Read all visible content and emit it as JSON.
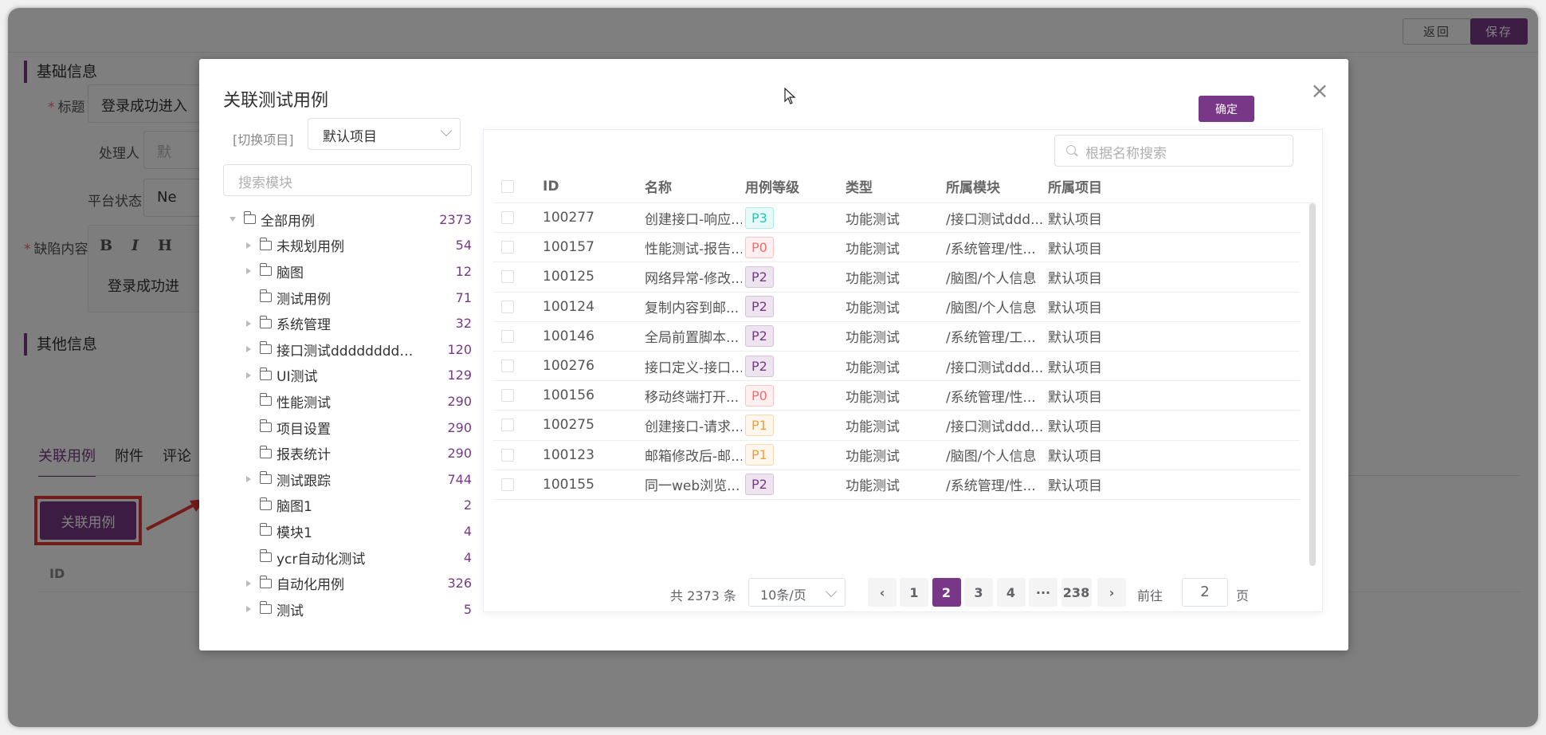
{
  "header": {
    "back_label": "返回",
    "save_label": "保存"
  },
  "form": {
    "basic_section": "基础信息",
    "title_label": "标题",
    "title_value": "登录成功进入",
    "handler_label": "处理人",
    "handler_value": "默",
    "status_label": "平台状态",
    "status_value": "Ne",
    "content_label": "缺陷内容",
    "content_value": "登录成功进",
    "editor_tools": [
      "B",
      "I",
      "H"
    ],
    "other_section": "其他信息",
    "tabs": [
      "关联用例",
      "附件",
      "评论"
    ],
    "relate_button": "关联用例",
    "table_id_header": "ID"
  },
  "dialog": {
    "title": "关联测试用例",
    "confirm_label": "确定",
    "switch_project_label": "[切换项目]",
    "project_value": "默认项目",
    "module_search_placeholder": "搜索模块",
    "name_search_placeholder": "根据名称搜索",
    "tree": [
      {
        "label": "全部用例",
        "count": "2373",
        "level": 0,
        "toggle": "open"
      },
      {
        "label": "未规划用例",
        "count": "54",
        "level": 1,
        "toggle": "closed"
      },
      {
        "label": "脑图",
        "count": "12",
        "level": 1,
        "toggle": "closed"
      },
      {
        "label": "测试用例",
        "count": "71",
        "level": 1,
        "toggle": "none"
      },
      {
        "label": "系统管理",
        "count": "32",
        "level": 1,
        "toggle": "closed"
      },
      {
        "label": "接口测试dddddddddd...",
        "count": "120",
        "level": 1,
        "toggle": "closed"
      },
      {
        "label": "UI测试",
        "count": "129",
        "level": 1,
        "toggle": "closed"
      },
      {
        "label": "性能测试",
        "count": "290",
        "level": 1,
        "toggle": "none"
      },
      {
        "label": "项目设置",
        "count": "290",
        "level": 1,
        "toggle": "none"
      },
      {
        "label": "报表统计",
        "count": "290",
        "level": 1,
        "toggle": "none"
      },
      {
        "label": "测试跟踪",
        "count": "744",
        "level": 1,
        "toggle": "closed"
      },
      {
        "label": "脑图1",
        "count": "2",
        "level": 1,
        "toggle": "none"
      },
      {
        "label": "模块1",
        "count": "4",
        "level": 1,
        "toggle": "none"
      },
      {
        "label": "ycr自动化测试",
        "count": "4",
        "level": 1,
        "toggle": "none"
      },
      {
        "label": "自动化用例",
        "count": "326",
        "level": 1,
        "toggle": "closed"
      },
      {
        "label": "测试",
        "count": "5",
        "level": 1,
        "toggle": "closed"
      }
    ],
    "columns": [
      "ID",
      "名称",
      "用例等级",
      "类型",
      "所属模块",
      "所属项目"
    ],
    "rows": [
      {
        "id": "100277",
        "name": "创建接口-响应...",
        "level": "P3",
        "type": "功能测试",
        "module": "/接口测试ddd...",
        "project": "默认项目"
      },
      {
        "id": "100157",
        "name": "性能测试-报告...",
        "level": "P0",
        "type": "功能测试",
        "module": "/系统管理/性...",
        "project": "默认项目"
      },
      {
        "id": "100125",
        "name": "网络异常-修改...",
        "level": "P2",
        "type": "功能测试",
        "module": "/脑图/个人信息",
        "project": "默认项目"
      },
      {
        "id": "100124",
        "name": "复制内容到邮...",
        "level": "P2",
        "type": "功能测试",
        "module": "/脑图/个人信息",
        "project": "默认项目"
      },
      {
        "id": "100146",
        "name": "全局前置脚本...",
        "level": "P2",
        "type": "功能测试",
        "module": "/系统管理/工...",
        "project": "默认项目"
      },
      {
        "id": "100276",
        "name": "接口定义-接口...",
        "level": "P2",
        "type": "功能测试",
        "module": "/接口测试ddd...",
        "project": "默认项目"
      },
      {
        "id": "100156",
        "name": "移动终端打开...",
        "level": "P0",
        "type": "功能测试",
        "module": "/系统管理/性...",
        "project": "默认项目"
      },
      {
        "id": "100275",
        "name": "创建接口-请求...",
        "level": "P1",
        "type": "功能测试",
        "module": "/接口测试ddd...",
        "project": "默认项目"
      },
      {
        "id": "100123",
        "name": "邮箱修改后-邮...",
        "level": "P1",
        "type": "功能测试",
        "module": "/脑图/个人信息",
        "project": "默认项目"
      },
      {
        "id": "100155",
        "name": "同一web浏览...",
        "level": "P2",
        "type": "功能测试",
        "module": "/系统管理/性...",
        "project": "默认项目"
      }
    ],
    "level_colors": {
      "P0": {
        "fg": "#f56c6c",
        "bg": "#fef0f0",
        "border": "#fbc4c4"
      },
      "P1": {
        "fg": "#e6a23c",
        "bg": "#fdf6ec",
        "border": "#f5dab1"
      },
      "P2": {
        "fg": "#783887",
        "bg": "#ede4f0",
        "border": "#d6c1dc"
      },
      "P3": {
        "fg": "#1ec9b8",
        "bg": "#e8faf8",
        "border": "#a8ede6"
      }
    },
    "pagination": {
      "total_text": "共 2373 条",
      "page_size": "10条/页",
      "pages": [
        "1",
        "2",
        "3",
        "4",
        "···",
        "238"
      ],
      "current": "2",
      "goto_label": "前往",
      "goto_value": "2",
      "page_suffix": "页"
    }
  },
  "colors": {
    "accent": "#783887",
    "highlight": "#e53935"
  }
}
